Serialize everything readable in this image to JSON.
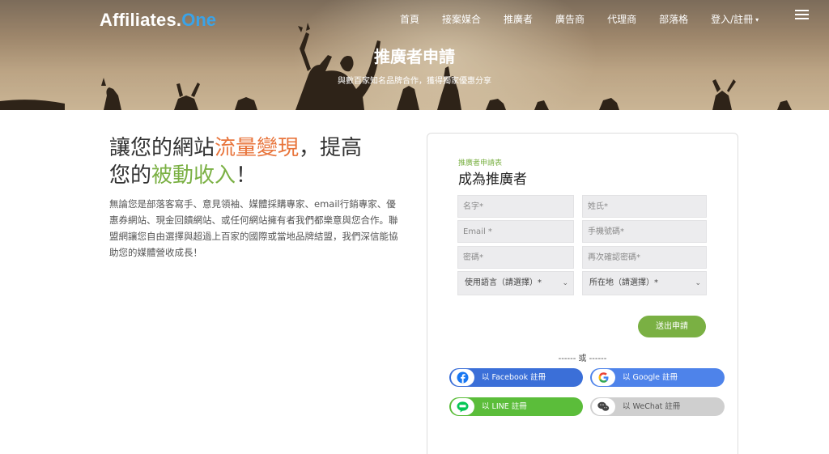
{
  "header": {
    "logo_main": "Affiliates.",
    "logo_accent": "One",
    "nav": [
      "首頁",
      "接案媒合",
      "推廣者",
      "廣告商",
      "代理商",
      "部落格",
      "登入/註冊"
    ],
    "nav_caret": "▾",
    "menu_icon": "hamburger-icon"
  },
  "hero": {
    "title": "推廣者申請",
    "subtitle": "與數百家知名品牌合作，獲得獨家優惠分享"
  },
  "intro": {
    "headline_1": "讓您的網站",
    "headline_2": "流量變現",
    "headline_3": "，提高",
    "headline_4": "您的",
    "headline_5": "被動收入",
    "headline_6": "！",
    "description": "無論您是部落客寫手、意見領袖、媒體採購專家、email行銷專家、優惠券網站、現金回饋網站、或任何網站擁有者我們都樂意與您合作。聯盟網讓您自由選擇與超過上百家的國際或當地品牌結盟，我們深信能協助您的媒體營收成長！"
  },
  "form": {
    "tag": "推廣者申請表",
    "title": "成為推廣者",
    "first_name_ph": "名字*",
    "last_name_ph": "姓氏*",
    "email_ph": "Email *",
    "phone_ph": "手機號碼*",
    "password_ph": "密碼*",
    "confirm_ph": "再次確認密碼*",
    "language_select": "使用語言（請選擇）*",
    "location_select": "所在地（請選擇）*",
    "submit": "送出申請",
    "or_divider": "------ 或 ------",
    "facebook": "以 Facebook 註冊",
    "google": "以 Google 註冊",
    "line": "以 LINE 註冊",
    "wechat": "以 WeChat 註冊"
  },
  "colors": {
    "accent_green": "#7ab043",
    "accent_orange": "#e8743b",
    "logo_blue": "#3aa3e8",
    "facebook_blue": "#3b6fd8",
    "google_blue": "#4e83ea",
    "line_green": "#5bbd3a",
    "wechat_gray": "#cfcfcf"
  }
}
